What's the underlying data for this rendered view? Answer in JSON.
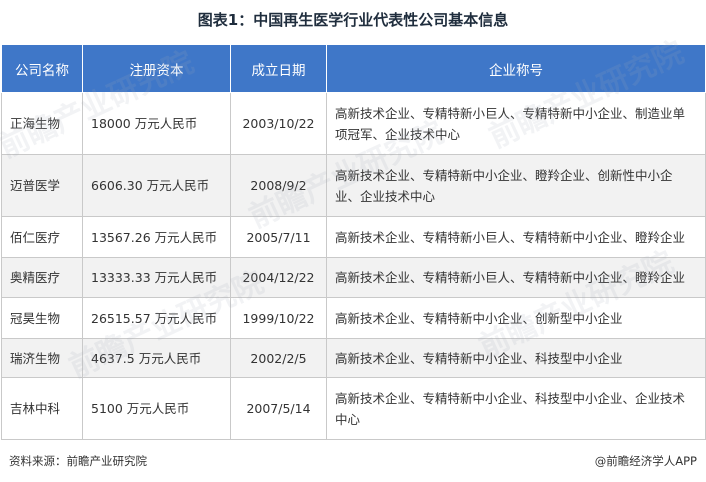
{
  "title": "图表1：中国再生医学行业代表性公司基本信息",
  "table": {
    "headers": [
      "公司名称",
      "注册资本",
      "成立日期",
      "企业称号"
    ],
    "rows": [
      {
        "name": "正海生物",
        "capital": "18000 万元人民币",
        "date": "2003/10/22",
        "titles": "高新技术企业、专精特新小巨人、专精特新中小企业、制造业单项冠军、企业技术中心"
      },
      {
        "name": "迈普医学",
        "capital": "6606.30 万元人民币",
        "date": "2008/9/2",
        "titles": "高新技术企业、专精特新中小企业、瞪羚企业、创新性中小企业、企业技术中心"
      },
      {
        "name": "佰仁医疗",
        "capital": "13567.26 万元人民币",
        "date": "2005/7/11",
        "titles": "高新技术企业、专精特新小巨人、专精特新中小企业、瞪羚企业"
      },
      {
        "name": "奥精医疗",
        "capital": "13333.33 万元人民币",
        "date": "2004/12/22",
        "titles": "高新技术企业、专精特新小巨人、专精特新中小企业、瞪羚企业"
      },
      {
        "name": "冠昊生物",
        "capital": "26515.57 万元人民币",
        "date": "1999/10/22",
        "titles": "高新技术企业、专精特新中小企业、创新型中小企业"
      },
      {
        "name": "瑞济生物",
        "capital": "4637.5 万元人民币",
        "date": "2002/2/5",
        "titles": "高新技术企业、专精特新中小企业、科技型中小企业"
      },
      {
        "name": "吉林中科",
        "capital": "5100 万元人民币",
        "date": "2007/5/14",
        "titles": "高新技术企业、专精特新中小企业、科技型中小企业、企业技术中心"
      }
    ]
  },
  "footer": {
    "source": "资料来源：前瞻产业研究院",
    "brand": "@前瞻经济学人APP"
  },
  "watermark": "前瞻产业研究院",
  "colors": {
    "header_bg": "#3f77c8",
    "header_text": "#ffffff",
    "row_alt_bg": "#f2f2f2",
    "border": "#c9c9c9"
  }
}
